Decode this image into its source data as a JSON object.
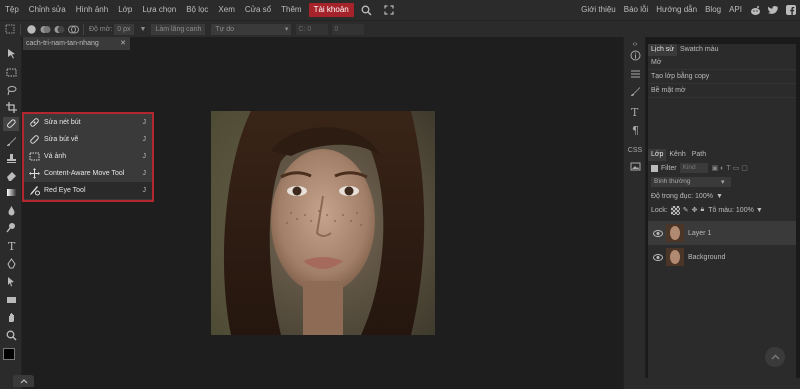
{
  "menubar": {
    "items": [
      "Tệp",
      "Chỉnh sửa",
      "Hình ảnh",
      "Lớp",
      "Lựa chọn",
      "Bộ lọc",
      "Xem",
      "Cửa sổ",
      "Thêm"
    ],
    "active_item": "Tài khoản",
    "right_links": [
      "Giới thiệu",
      "Báo lỗi",
      "Hướng dẫn",
      "Blog",
      "API"
    ]
  },
  "options": {
    "feather_label": "Độ mờ:",
    "feather_value": "0 px",
    "smooth_button": "Làm lăng canh",
    "style_select": "Tự do",
    "w_label": "C:",
    "w_value": "0",
    "h_value": "0"
  },
  "doc_tab": {
    "title": "cach-tri-nam-tan-nhang",
    "close": "✕"
  },
  "flyout": {
    "items": [
      {
        "label": "Sửa nét bút",
        "key": "J",
        "icon": "spot-healing-brush-icon"
      },
      {
        "label": "Sửa bút vẽ",
        "key": "J",
        "icon": "healing-brush-icon"
      },
      {
        "label": "Vá ảnh",
        "key": "J",
        "icon": "patch-tool-icon"
      },
      {
        "label": "Content-Aware Move Tool",
        "key": "J",
        "icon": "content-aware-move-icon"
      },
      {
        "label": "Red Eye Tool",
        "key": "J",
        "icon": "red-eye-icon"
      }
    ]
  },
  "history_panel": {
    "tabs": [
      "Lịch sử",
      "Swatch màu"
    ],
    "rows": [
      "Mở",
      "Tạo lớp bằng copy",
      "Bề mặt mờ"
    ]
  },
  "layers_panel": {
    "tabs": [
      "Lớp",
      "Kênh",
      "Path"
    ],
    "filter_label": "Filter",
    "filter_kind": "Kind",
    "blend_mode": "Bình thường",
    "opacity_label": "Độ trong đục:",
    "opacity_value": "100%",
    "lock_label": "Lock:",
    "fill_label": "Tô màu:",
    "fill_value": "100%",
    "layers": [
      {
        "name": "Layer 1",
        "selected": true
      },
      {
        "name": "Background",
        "selected": false
      }
    ]
  },
  "side_icons": {
    "css_label": "CSS"
  }
}
